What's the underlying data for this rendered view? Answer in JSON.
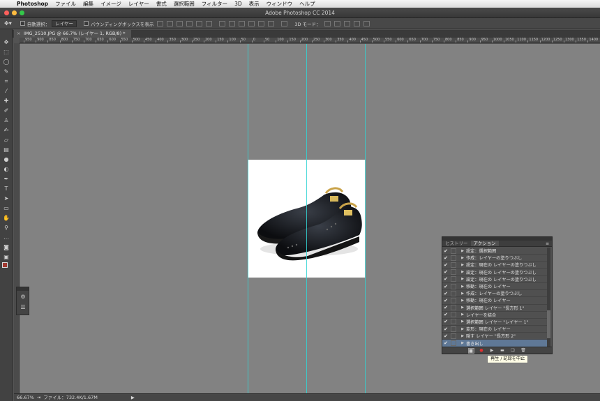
{
  "menubar": {
    "app": "Photoshop",
    "items": [
      "ファイル",
      "編集",
      "イメージ",
      "レイヤー",
      "書式",
      "選択範囲",
      "フィルター",
      "3D",
      "表示",
      "ウィンドウ",
      "ヘルプ"
    ]
  },
  "window": {
    "title": "Adobe Photoshop CC 2014"
  },
  "options": {
    "auto_select_label": "自動選択：",
    "auto_select_value": "レイヤー",
    "bbox_label": "バウンディングボックスを表示",
    "mode_label": "3D モード："
  },
  "document": {
    "tab_title": "IMG_2510.JPG @ 66.7% (レイヤー 1, RGB/8) *"
  },
  "ruler": {
    "labels": [
      "950",
      "900",
      "850",
      "800",
      "750",
      "700",
      "650",
      "600",
      "550",
      "500",
      "450",
      "400",
      "350",
      "300",
      "250",
      "200",
      "150",
      "100",
      "50",
      "0",
      "50",
      "100",
      "150",
      "200",
      "250",
      "300",
      "350",
      "400",
      "450",
      "500",
      "550",
      "600",
      "650",
      "700",
      "750",
      "800",
      "850",
      "900",
      "950",
      "1000",
      "1050",
      "1100",
      "1150",
      "1200",
      "1250",
      "1300",
      "1350",
      "1400",
      "1450"
    ]
  },
  "status": {
    "zoom": "66.67%",
    "file_info": "ファイル：732.4K/1.67M"
  },
  "panel": {
    "tabs": [
      "ヒストリー",
      "アクション"
    ],
    "active_tab": 1,
    "menu_icon": "≡",
    "rows": [
      {
        "label": "設定：選択範囲",
        "selected": false
      },
      {
        "label": "作成：レイヤーの塗りつぶし",
        "selected": false
      },
      {
        "label": "設定：現在の レイヤーの塗りつぶし",
        "selected": false
      },
      {
        "label": "設定：現在の レイヤーの塗りつぶし",
        "selected": false
      },
      {
        "label": "設定：現在の レイヤーの塗りつぶし",
        "selected": false
      },
      {
        "label": "移動：現在の レイヤー",
        "selected": false
      },
      {
        "label": "作成：レイヤーの塗りつぶし",
        "selected": false
      },
      {
        "label": "移動：現在の レイヤー",
        "selected": false
      },
      {
        "label": "選択範囲 レイヤー \"長方形 1\"",
        "selected": false
      },
      {
        "label": "レイヤーを結合",
        "selected": false
      },
      {
        "label": "選択範囲 レイヤー \"レイヤー 1\"",
        "selected": false
      },
      {
        "label": "変形：現在の レイヤー",
        "selected": false
      },
      {
        "label": "隠す レイヤー \"長方形 2\"",
        "selected": false
      },
      {
        "label": "書き出し",
        "selected": true
      }
    ],
    "tooltip": "再生 / 記録を中止"
  },
  "colors": {
    "canvas": "#828282",
    "guide": "#33d4d4",
    "selection": "#5f7896",
    "foreground": "#a23a32"
  }
}
